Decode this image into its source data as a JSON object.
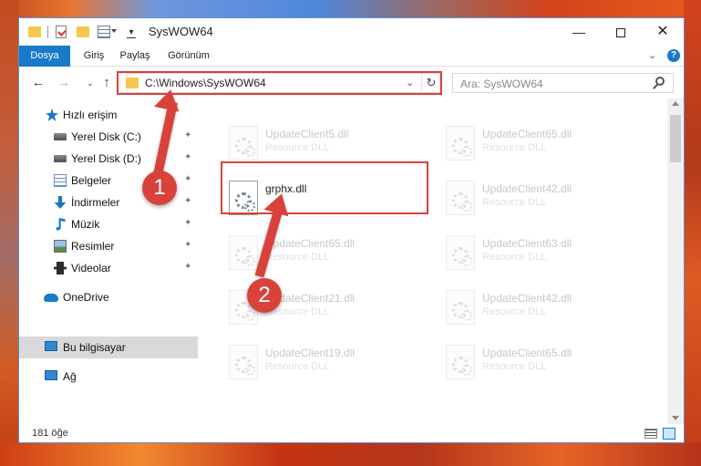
{
  "window": {
    "title": "SysWOW64",
    "controls": {
      "minimize": "—",
      "maximize": "",
      "close": "✕"
    }
  },
  "ribbon": {
    "tabs": [
      "Dosya",
      "Giriş",
      "Paylaş",
      "Görünüm"
    ],
    "expand_chevron": "⌄",
    "help": "?"
  },
  "navigation": {
    "back": "←",
    "forward": "→",
    "recent": "⌄",
    "up": "↑",
    "address": "C:\\Windows\\SysWOW64",
    "address_dropdown": "⌄",
    "refresh": "↻",
    "search_placeholder": "Ara: SysWOW64"
  },
  "sidebar": {
    "pin_glyph": "✦",
    "items": [
      {
        "label": "Hızlı erişim",
        "icon": "star-icon",
        "pinned": false
      },
      {
        "label": "Yerel Disk (C:)",
        "icon": "disk-icon",
        "pinned": true
      },
      {
        "label": "Yerel Disk (D:)",
        "icon": "disk-icon",
        "pinned": true
      },
      {
        "label": "Belgeler",
        "icon": "documents-icon",
        "pinned": true
      },
      {
        "label": "İndirmeler",
        "icon": "downloads-icon",
        "pinned": true
      },
      {
        "label": "Müzik",
        "icon": "music-icon",
        "pinned": true
      },
      {
        "label": "Resimler",
        "icon": "pictures-icon",
        "pinned": true
      },
      {
        "label": "Videolar",
        "icon": "videos-icon",
        "pinned": true
      },
      {
        "label": "OneDrive",
        "icon": "cloud-icon",
        "pinned": false
      },
      {
        "label": "Bu bilgisayar",
        "icon": "computer-icon",
        "pinned": false,
        "selected": true
      },
      {
        "label": "Ağ",
        "icon": "network-icon",
        "pinned": false
      }
    ]
  },
  "files": {
    "focused": {
      "name": "grphx.dll",
      "type": ""
    },
    "left_column": [
      {
        "name": "UpdateClient5.dll",
        "type": "Resource DLL"
      },
      {
        "name": "UpdateClient65.dll",
        "type": "Resource DLL"
      },
      {
        "name": "UpdateClient21.dll",
        "type": "Resource DLL"
      },
      {
        "name": "UpdateClient19.dll",
        "type": "Resource DLL"
      }
    ],
    "right_column": [
      {
        "name": "UpdateClient65.dll",
        "type": "Resource DLL"
      },
      {
        "name": "UpdateClient42.dll",
        "type": "Resource DLL"
      },
      {
        "name": "UpdateClient63.dll",
        "type": "Resource DLL"
      },
      {
        "name": "UpdateClient42.dll",
        "type": "Resource DLL"
      },
      {
        "name": "UpdateClient65.dll",
        "type": "Resource DLL"
      }
    ]
  },
  "status": {
    "item_count": "181 öğe"
  },
  "callouts": [
    "1",
    "2"
  ],
  "colors": {
    "accent": "#1979ca",
    "annotation": "#d8423b"
  }
}
